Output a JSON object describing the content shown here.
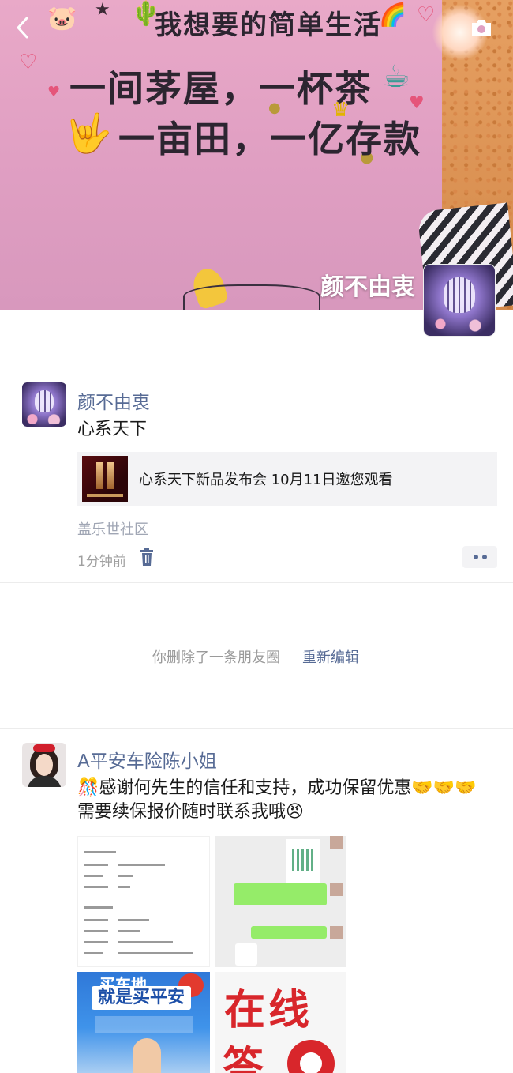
{
  "cover": {
    "line1": "我想要的简单生活",
    "line2": "一间茅屋，一杯茶",
    "line3": "一亩田，一亿存款",
    "owner_name": "颜不由衷"
  },
  "posts": [
    {
      "nickname": "颜不由衷",
      "text": "心系天下",
      "link_title": "心系天下新品发布会 10月11日邀您观看",
      "source": "盖乐世社区",
      "time": "1分钟前"
    }
  ],
  "deleted_notice": {
    "text": "你删除了一条朋友圈",
    "action": "重新编辑"
  },
  "post2": {
    "nickname": "A平安车险陈小姐",
    "line1": "🎊感谢何先生的信任和支持，成功保留优惠🤝🤝🤝",
    "line2": "需要续保报价随时联系我哦😠",
    "poster_top": "买车地",
    "poster_main": "就是买平安",
    "online_a": "在线",
    "online_b": "答"
  },
  "colors": {
    "link_blue": "#576b95",
    "meta_gray": "#a0a0a0",
    "card_bg": "#f3f3f5"
  },
  "icons": [
    "back-chevron-icon",
    "camera-icon",
    "trash-icon",
    "more-dots-icon"
  ]
}
